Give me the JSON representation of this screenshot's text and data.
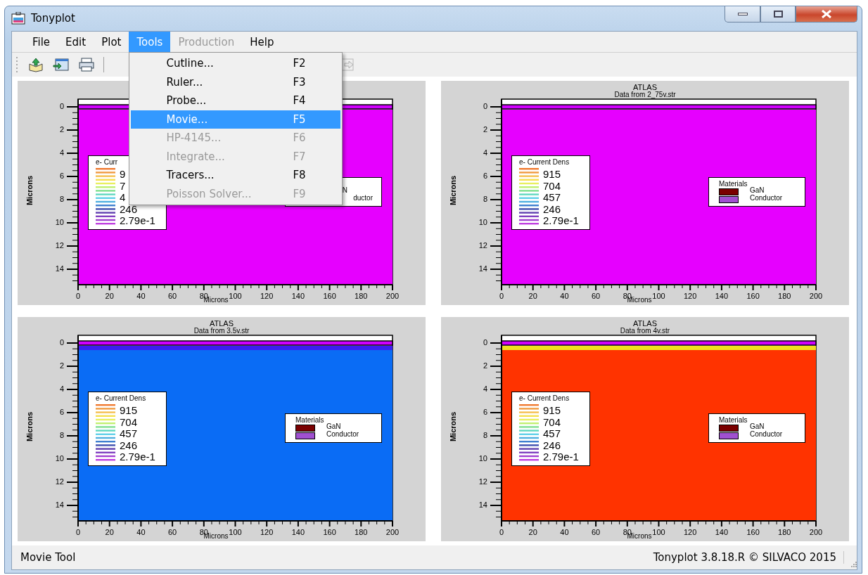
{
  "window": {
    "title": "Tonyplot"
  },
  "menu_bar": [
    {
      "label": "File",
      "selected": false,
      "disabled": false
    },
    {
      "label": "Edit",
      "selected": false,
      "disabled": false
    },
    {
      "label": "Plot",
      "selected": false,
      "disabled": false
    },
    {
      "label": "Tools",
      "selected": true,
      "disabled": false
    },
    {
      "label": "Production",
      "selected": false,
      "disabled": true
    },
    {
      "label": "Help",
      "selected": false,
      "disabled": false
    }
  ],
  "tools_menu": [
    {
      "label": "Cutline...",
      "shortcut": "F2",
      "selected": false,
      "disabled": false
    },
    {
      "label": "Ruler...",
      "shortcut": "F3",
      "selected": false,
      "disabled": false
    },
    {
      "label": "Probe...",
      "shortcut": "F4",
      "selected": false,
      "disabled": false
    },
    {
      "label": "Movie...",
      "shortcut": "F5",
      "selected": true,
      "disabled": false
    },
    {
      "label": "HP-4145...",
      "shortcut": "F6",
      "selected": false,
      "disabled": true
    },
    {
      "label": "Integrate...",
      "shortcut": "F7",
      "selected": false,
      "disabled": true
    },
    {
      "label": "Tracers...",
      "shortcut": "F8",
      "selected": false,
      "disabled": false
    },
    {
      "label": "Poisson Solver...",
      "shortcut": "F9",
      "selected": false,
      "disabled": true
    }
  ],
  "plots": [
    {
      "color": "#e600ff",
      "ylabel": "Microns",
      "xlabel": "Microns",
      "yticks": [
        "0",
        "2",
        "4",
        "6",
        "8",
        "10",
        "12",
        "14"
      ],
      "xticks": [
        "0",
        "20",
        "40",
        "60",
        "80",
        "100",
        "120",
        "140",
        "160",
        "180",
        "200"
      ],
      "current_legend": {
        "title": "e- Curr",
        "values": [
          "9",
          "7",
          "4",
          "246",
          "2.79e-1"
        ]
      },
      "materials_legend": {
        "cut": true,
        "items": [
          {
            "name": "N"
          },
          {
            "name": "ductor"
          }
        ]
      }
    },
    {
      "title": "ATLAS",
      "subtitle": "Data from 2_75v.str",
      "color": "#e600ff",
      "ylabel": "Microns",
      "xlabel": "Microns",
      "yticks": [
        "0",
        "2",
        "4",
        "6",
        "8",
        "10",
        "12",
        "14"
      ],
      "xticks": [
        "0",
        "20",
        "40",
        "60",
        "80",
        "100",
        "120",
        "140",
        "160",
        "180",
        "200"
      ],
      "current_legend": {
        "title": "e- Current Dens",
        "values": [
          "915",
          "704",
          "457",
          "246",
          "2.79e-1"
        ]
      },
      "materials_legend": {
        "title": "Materials",
        "cut": false,
        "items": [
          {
            "name": "GaN",
            "color": "#7a0000"
          },
          {
            "name": "Conductor",
            "color": "#a050d0"
          }
        ]
      }
    },
    {
      "title": "ATLAS",
      "subtitle": "Data from 3.5v.str",
      "color": "#0a6cf5",
      "surface_band": {
        "color": "#3a20f0"
      },
      "ylabel": "Microns",
      "xlabel": "Microns",
      "yticks": [
        "0",
        "2",
        "4",
        "6",
        "8",
        "10",
        "12",
        "14"
      ],
      "xticks": [
        "0",
        "20",
        "40",
        "60",
        "80",
        "100",
        "120",
        "140",
        "160",
        "180",
        "200"
      ],
      "current_legend": {
        "title": "e- Current Dens",
        "values": [
          "915",
          "704",
          "457",
          "246",
          "2.79e-1"
        ]
      },
      "materials_legend": {
        "title": "Materials",
        "cut": false,
        "items": [
          {
            "name": "GaN",
            "color": "#7a0000"
          },
          {
            "name": "Conductor",
            "color": "#a050d0"
          }
        ]
      }
    },
    {
      "title": "ATLAS",
      "subtitle": "Data from 4v.str",
      "color": "#ff3300",
      "surface_band": {
        "color": "#f0e020"
      },
      "ylabel": "Microns",
      "xlabel": "Microns",
      "yticks": [
        "0",
        "2",
        "4",
        "6",
        "8",
        "10",
        "12",
        "14"
      ],
      "xticks": [
        "0",
        "20",
        "40",
        "60",
        "80",
        "100",
        "120",
        "140",
        "160",
        "180",
        "200"
      ],
      "current_legend": {
        "title": "e- Current Dens",
        "values": [
          "915",
          "704",
          "457",
          "246",
          "2.79e-1"
        ]
      },
      "materials_legend": {
        "title": "Materials",
        "cut": false,
        "items": [
          {
            "name": "GaN",
            "color": "#7a0000"
          },
          {
            "name": "Conductor",
            "color": "#a050d0"
          }
        ]
      }
    }
  ],
  "status_bar": {
    "message": "Movie Tool",
    "version": "Tonyplot 3.8.18.R © SILVACO 2015"
  }
}
